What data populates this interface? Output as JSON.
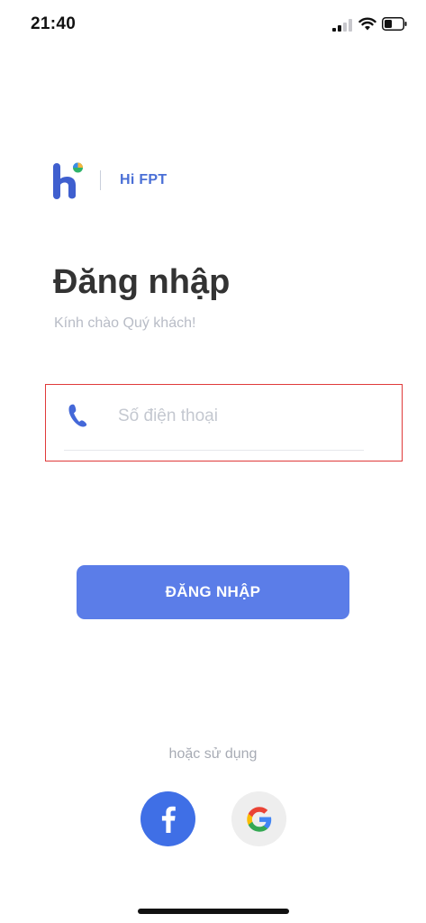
{
  "status_bar": {
    "time": "21:40",
    "signal_icon": "cellular-signal-icon",
    "wifi_icon": "wifi-icon",
    "battery_icon": "battery-icon"
  },
  "brand": {
    "logo_icon": "hi-fpt-logo-icon",
    "name": "Hi FPT"
  },
  "login": {
    "title": "Đăng nhập",
    "subtitle": "Kính chào Quý khách!",
    "phone_placeholder": "Số điện thoại",
    "phone_value": "",
    "phone_icon": "phone-icon",
    "button_label": "ĐĂNG NHẬP"
  },
  "alternative": {
    "label": "hoặc sử dụng",
    "facebook_icon": "facebook-icon",
    "google_icon": "google-icon"
  },
  "colors": {
    "accent": "#5b7de8",
    "brand_text": "#4a6fd6",
    "facebook": "#3f6fe6",
    "highlight_border": "#e03a3a"
  }
}
